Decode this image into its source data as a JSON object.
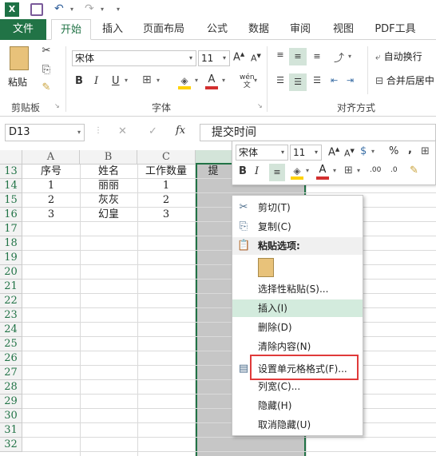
{
  "qat": {
    "app_icon": "X",
    "undo": "↶",
    "redo": "↷",
    "customize": "▾"
  },
  "tabs": [
    "文件",
    "开始",
    "插入",
    "页面布局",
    "公式",
    "数据",
    "审阅",
    "视图",
    "PDF工具"
  ],
  "ribbon": {
    "clipboard": {
      "paste": "粘贴",
      "group_label": "剪贴板"
    },
    "font": {
      "font_name": "宋体",
      "font_size": "11",
      "bold": "B",
      "italic": "I",
      "underline": "U",
      "phonetic": "wén",
      "group_label": "字体"
    },
    "alignment": {
      "wrap_text": "自动换行",
      "merge_center": "合并后居中",
      "group_label": "对齐方式"
    }
  },
  "formula_bar": {
    "name_box": "D13",
    "fx": "fx",
    "value": "提交时间"
  },
  "columns": [
    "A",
    "B",
    "C"
  ],
  "rows": [
    "13",
    "14",
    "15",
    "16",
    "17",
    "18",
    "19",
    "20",
    "21",
    "22",
    "23",
    "24",
    "25",
    "26",
    "27",
    "28",
    "29",
    "30",
    "31",
    "32"
  ],
  "cells": {
    "header": [
      "序号",
      "姓名",
      "工作数量",
      "提"
    ],
    "r14": [
      "1",
      "丽丽",
      "1"
    ],
    "r15": [
      "2",
      "灰灰",
      "2"
    ],
    "r16": [
      "3",
      "幻皇",
      "3"
    ]
  },
  "mini_toolbar": {
    "font": "宋体",
    "size": "11",
    "bold": "B",
    "italic": "I",
    "percent": "%",
    "comma": ",",
    "dec_inc": ".00",
    "dec_dec": ".0"
  },
  "context_menu": {
    "cut": "剪切(T)",
    "copy": "复制(C)",
    "paste_options": "粘贴选项:",
    "paste_special": "选择性粘贴(S)...",
    "insert": "插入(I)",
    "delete": "删除(D)",
    "clear": "清除内容(N)",
    "format_cells": "设置单元格格式(F)...",
    "col_width": "列宽(C)...",
    "hide": "隐藏(H)",
    "unhide": "取消隐藏(U)"
  },
  "colors": {
    "accent": "#217346",
    "highlight_red": "#e03a3a",
    "fill_yellow": "#ffd200",
    "font_red": "#d32f2f"
  }
}
